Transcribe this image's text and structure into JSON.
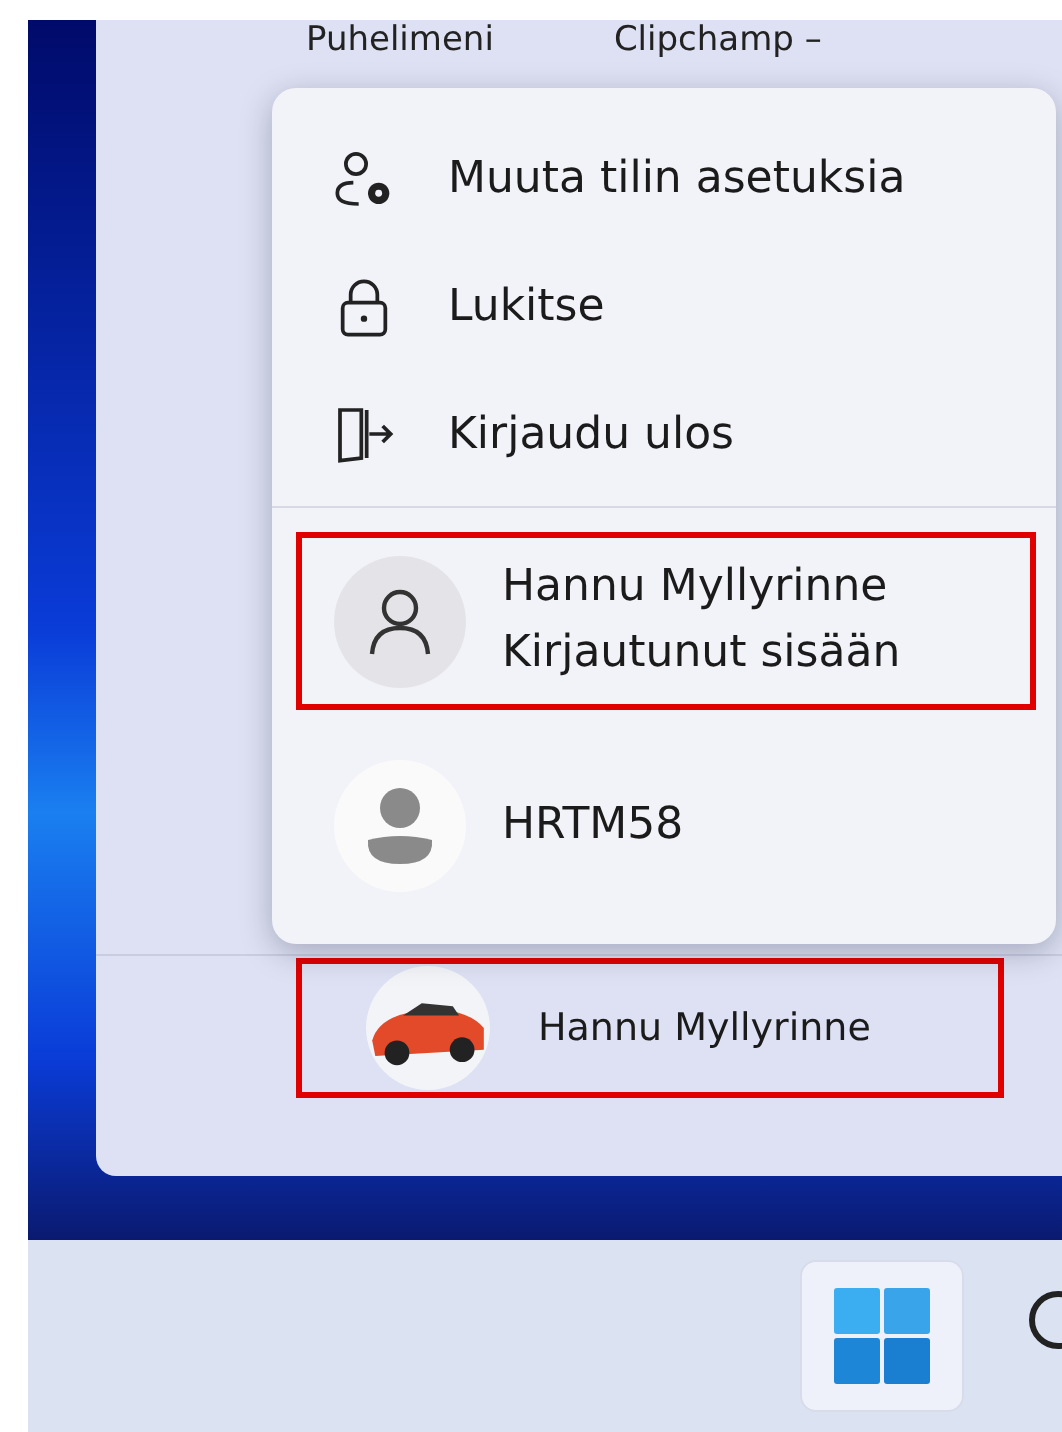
{
  "start_menu": {
    "app_labels": [
      "Puhelimeni",
      "Clipchamp –"
    ],
    "account_menu": {
      "actions": [
        {
          "kind": "settings",
          "label": "Muuta tilin asetuksia"
        },
        {
          "kind": "lock",
          "label": "Lukitse"
        },
        {
          "kind": "signout",
          "label": "Kirjaudu ulos"
        }
      ],
      "accounts": [
        {
          "kind": "outline",
          "name": "Hannu Myllyrinne",
          "status": "Kirjautunut sisään",
          "highlighted": true
        },
        {
          "kind": "filled",
          "name": "HRTM58",
          "highlighted": false
        }
      ]
    },
    "user_button": {
      "name": "Hannu Myllyrinne",
      "highlighted": true
    }
  }
}
